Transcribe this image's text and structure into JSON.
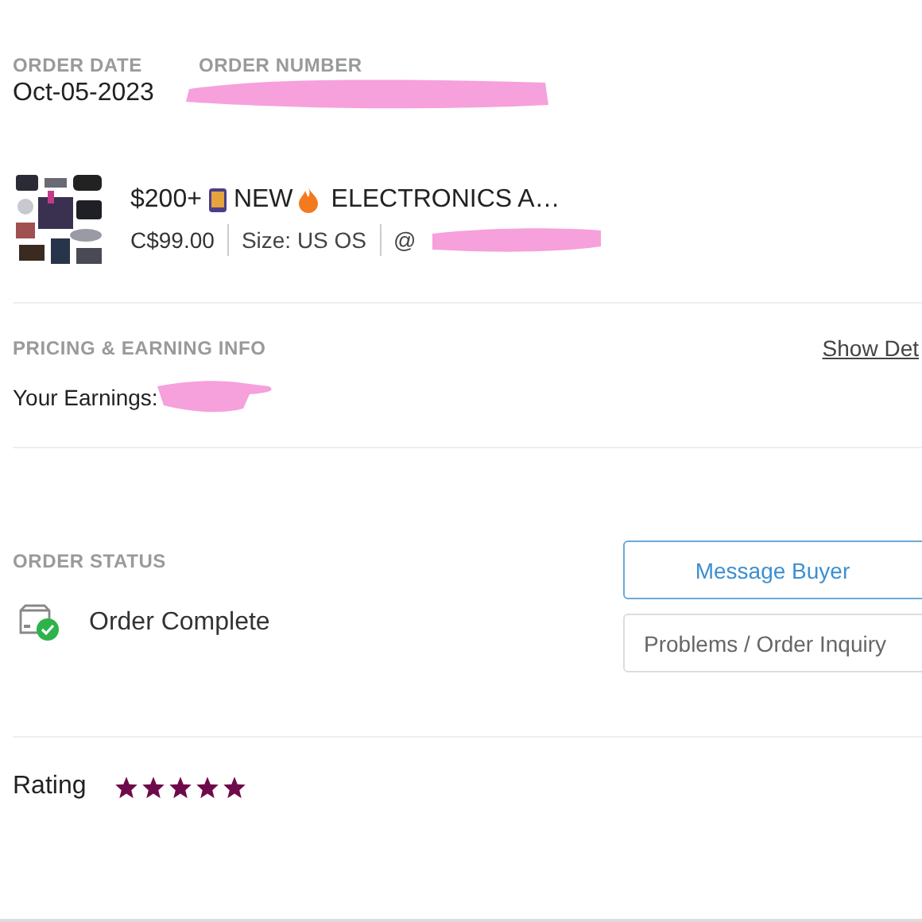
{
  "order": {
    "date_label": "ORDER DATE",
    "date": "Oct-05-2023",
    "number_label": "ORDER NUMBER"
  },
  "item": {
    "title_start": "$200+",
    "title_middle": "NEW",
    "title_end": "ELECTRONICS A…",
    "price": "C$99.00",
    "size": "Size: US OS",
    "buyer": "@"
  },
  "pricing": {
    "label": "PRICING & EARNING INFO",
    "link": "Show Det",
    "earnings": "Your Earnings: "
  },
  "status": {
    "label": "ORDER STATUS",
    "text": "Order Complete"
  },
  "buttons": [
    {
      "label": "Message Buyer",
      "kind": "primary"
    },
    {
      "label": "Problems / Order Inquiry",
      "kind": "secondary"
    }
  ],
  "rating": {
    "label": "Rating",
    "stars": 5
  }
}
